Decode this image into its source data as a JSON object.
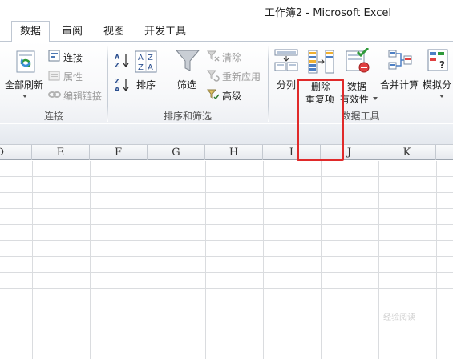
{
  "window": {
    "title": "工作簿2 - Microsoft Excel"
  },
  "tabs": [
    {
      "label": "数据",
      "active": true
    },
    {
      "label": "审阅",
      "active": false
    },
    {
      "label": "视图",
      "active": false
    },
    {
      "label": "开发工具",
      "active": false
    }
  ],
  "ribbon": {
    "connections": {
      "group_label": "连接",
      "refresh_all": "全部刷新",
      "connections": "连接",
      "properties": "属性",
      "edit_links": "编辑链接"
    },
    "sort_filter": {
      "group_label": "排序和筛选",
      "sort": "排序",
      "filter": "筛选",
      "clear": "清除",
      "reapply": "重新应用",
      "advanced": "高级"
    },
    "data_tools": {
      "group_label": "数据工具",
      "text_to_columns": "分列",
      "remove_dup_line1": "删除",
      "remove_dup_line2": "重复项",
      "validation_line1": "数据",
      "validation_line2": "有效性",
      "consolidate": "合并计算",
      "what_if": "模拟分"
    }
  },
  "sheet": {
    "columns": [
      "D",
      "E",
      "F",
      "G",
      "H",
      "I",
      "J",
      "K"
    ]
  },
  "watermark": "经验阅读"
}
